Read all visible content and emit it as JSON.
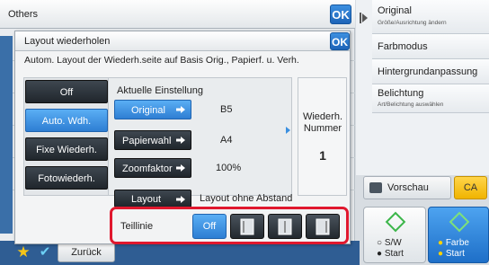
{
  "background": {
    "title": "Others",
    "ok_label": "OK"
  },
  "side_menu": [
    {
      "label": "Original",
      "sub": "Größe/Ausrichtung ändern"
    },
    {
      "label": "Farbmodus",
      "sub": ""
    },
    {
      "label": "Hintergrundanpassung",
      "sub": ""
    },
    {
      "label": "Belichtung",
      "sub": "Art/Belichtung auswählen"
    }
  ],
  "preview_label": "Vorschau",
  "ca_label": "CA",
  "start_bw": {
    "line1": "S/W",
    "line2": "Start"
  },
  "start_color": {
    "line1": "Farbe",
    "line2": "Start"
  },
  "bottom": {
    "back_label": "Zurück"
  },
  "dialog": {
    "title": "Layout wiederholen",
    "ok_label": "OK",
    "description": "Autom. Layout der Wiederh.seite auf Basis Orig., Papierf. u. Verh.",
    "modes": [
      {
        "label": "Off",
        "selected": false
      },
      {
        "label": "Auto. Wdh.",
        "selected": true
      },
      {
        "label": "Fixe Wiederh.",
        "selected": false
      },
      {
        "label": "Fotowiederh.",
        "selected": false
      }
    ],
    "current_settings_title": "Aktuelle Einstellung",
    "settings": [
      {
        "label": "Original",
        "value": "B5",
        "selected": true
      },
      {
        "label": "Papierwahl",
        "value": "A4",
        "selected": false
      },
      {
        "label": "Zoomfaktor",
        "value": "100%",
        "selected": false
      }
    ],
    "repeat_label_1": "Wiederh.",
    "repeat_label_2": "Nummer",
    "repeat_count": "1",
    "layout_label": "Layout",
    "layout_value": "Layout ohne Abstand",
    "divider_label": "Teillinie",
    "divider_off": "Off"
  },
  "colors": {
    "accent_blue": "#2e7ed3",
    "dark_button": "#20262c",
    "highlight_red": "#e0182e",
    "start_color_bg": "#1e6fc8"
  }
}
